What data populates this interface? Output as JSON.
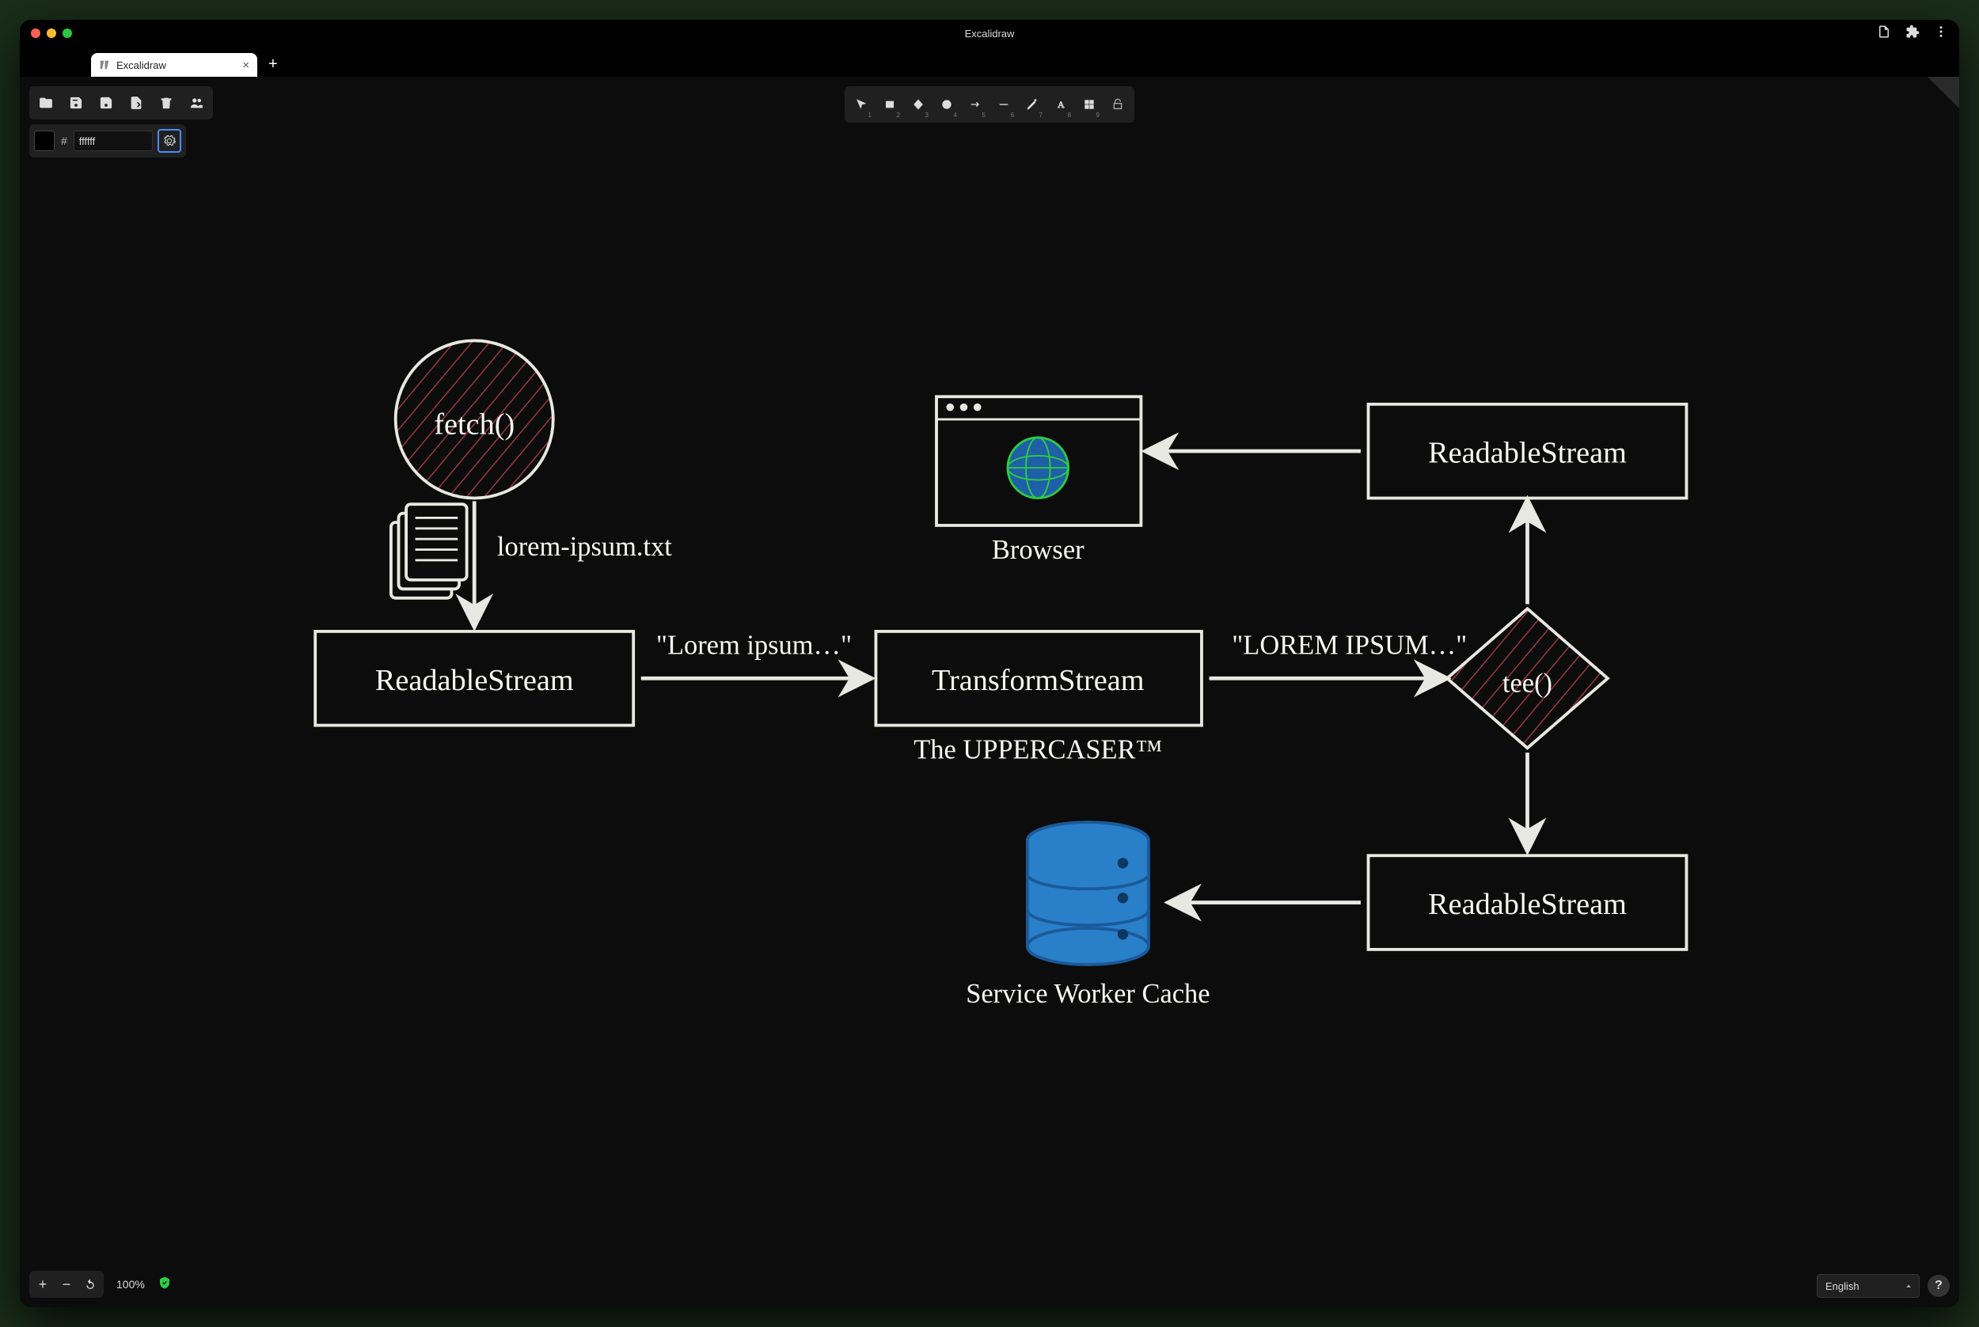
{
  "window": {
    "title": "Excalidraw",
    "tab_title": "Excalidraw"
  },
  "color_panel": {
    "hex_value": "ffffff"
  },
  "tools": {
    "labels": [
      "1",
      "2",
      "3",
      "4",
      "5",
      "6",
      "7",
      "8",
      "9"
    ]
  },
  "zoom": {
    "level": "100%"
  },
  "language": "English",
  "help_symbol": "?",
  "diagram": {
    "fetch_label": "fetch()",
    "file_label": "lorem-ipsum.txt",
    "readable1": "ReadableStream",
    "arrow1_text": "\"Lorem ipsum…\"",
    "transform": "TransformStream",
    "transform_sub": "The UPPERCASER™",
    "arrow2_text": "\"LOREM IPSUM…\"",
    "tee_label": "tee()",
    "readable2": "ReadableStream",
    "readable3": "ReadableStream",
    "browser_label": "Browser",
    "cache_label": "Service Worker Cache"
  }
}
